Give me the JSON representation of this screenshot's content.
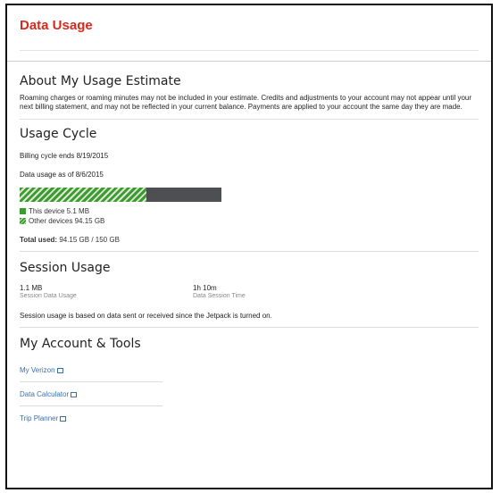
{
  "header": {
    "title": "Data Usage"
  },
  "about": {
    "heading": "About My Usage Estimate",
    "text": "Roaming charges or roaming minutes may not be included in your estimate. Credits and adjustments to your account may not appear until your next billing statement, and may not be reflected in your current balance. Payments are applied to your account the same day they are made."
  },
  "cycle": {
    "heading": "Usage Cycle",
    "billing_text": "Billing cycle ends 8/19/2015",
    "usage_text": "Data usage as of 8/6/2015",
    "bar": {
      "fill_fraction": 0.63
    },
    "legend": {
      "this_device": "This device 5.1 MB",
      "other_devices": "Other devices 94.15 GB"
    },
    "total_label": "Total used:",
    "total_value": "94.15 GB / 150 GB"
  },
  "session": {
    "heading": "Session Usage",
    "data_value": "1.1 MB",
    "data_label": "Session Data Usage",
    "time_value": "1h 10m",
    "time_label": "Data Session Time",
    "note": "Session usage is based on data sent or received since the Jetpack is turned on."
  },
  "tools": {
    "heading": "My Account & Tools",
    "links": [
      {
        "label": "My Verizon"
      },
      {
        "label": "Data Calculator"
      },
      {
        "label": "Trip Planner"
      }
    ]
  },
  "colors": {
    "brand": "#d52b1e",
    "usage_green": "#3d9b35",
    "bar_dark": "#4d4f53",
    "link": "#3c6fa8"
  }
}
